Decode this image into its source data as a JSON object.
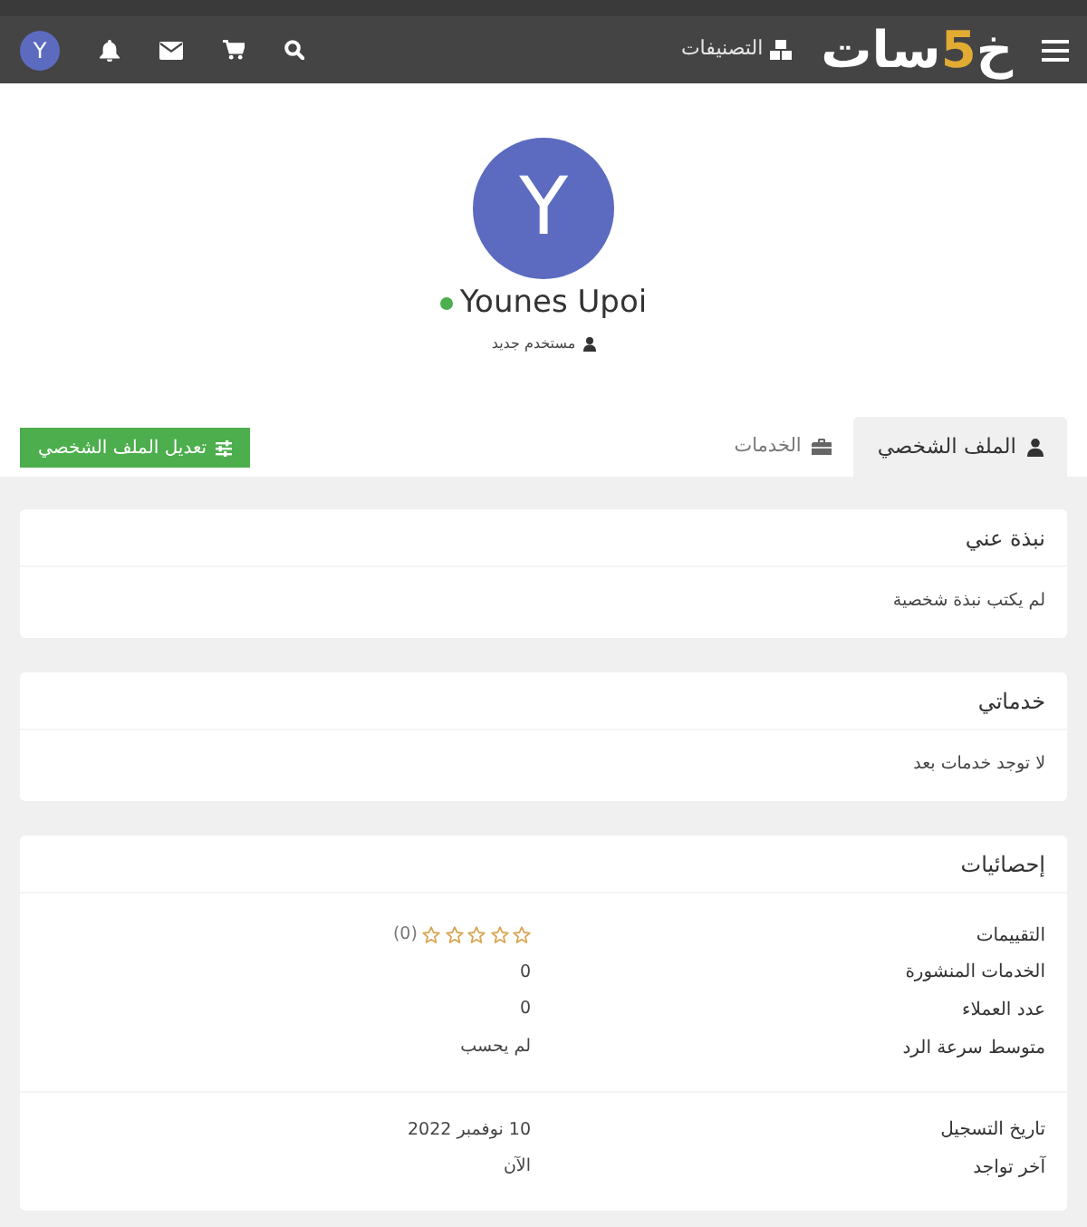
{
  "navbar": {
    "logo": {
      "before": "خ",
      "accent": "5",
      "after": "سات"
    },
    "categories_link": "التصنيفات",
    "user_avatar": "Y"
  },
  "profile": {
    "avatar_letter": "Y",
    "name": "Younes Upoi",
    "online": true,
    "role": "مستخدم جديد"
  },
  "tabs": [
    {
      "label": "الملف الشخصي",
      "selected": true
    },
    {
      "label": "الخدمات",
      "selected": false
    }
  ],
  "edit_button": "تعديل الملف الشخصي",
  "cards": [
    {
      "title": "نبذة عني",
      "body": "لم يكتب نبذة شخصية"
    },
    {
      "title": "خدماتي",
      "body": "لا توجد خدمات بعد"
    }
  ],
  "stats": {
    "title": "إحصائيات",
    "groups": [
      {
        "rows": [
          {
            "kind": "rating",
            "label": "التقييمات",
            "stars": 0,
            "value": "(0)"
          },
          {
            "kind": "text",
            "label": "الخدمات المنشورة",
            "value": "0"
          },
          {
            "kind": "text",
            "label": "عدد العملاء",
            "value": "0"
          },
          {
            "kind": "text",
            "label": "متوسط سرعة الرد",
            "value": "لم يحسب"
          }
        ]
      },
      {
        "rows": [
          {
            "kind": "text",
            "label": "تاريخ التسجيل",
            "value": "10 نوفمبر 2022"
          },
          {
            "kind": "text",
            "label": "آخر تواجد",
            "value": "الآن"
          }
        ]
      }
    ]
  }
}
